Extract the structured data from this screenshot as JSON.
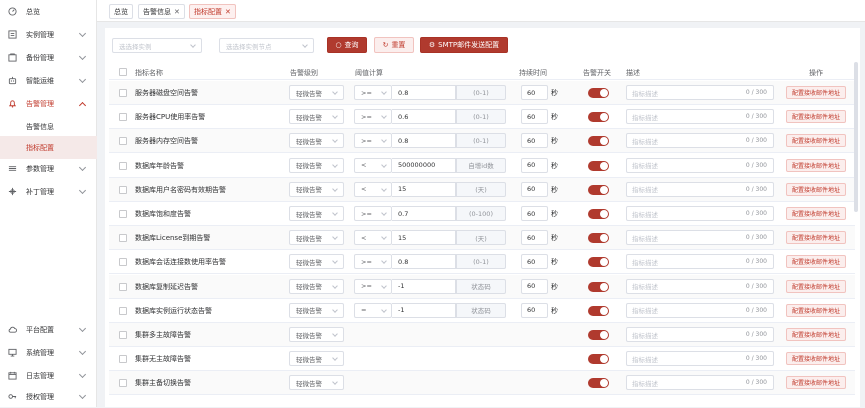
{
  "sidebar": {
    "items": [
      {
        "label": "总览",
        "icon": "gauge-icon"
      },
      {
        "label": "实例管理",
        "icon": "list-icon"
      },
      {
        "label": "备份管理",
        "icon": "backup-icon"
      },
      {
        "label": "智能运维",
        "icon": "robot-icon"
      },
      {
        "label": "告警管理",
        "icon": "bell-icon"
      },
      {
        "label": "参数管理",
        "icon": "sliders-icon"
      },
      {
        "label": "补丁管理",
        "icon": "patch-icon"
      },
      {
        "label": "平台配置",
        "icon": "cloud-icon"
      },
      {
        "label": "系统管理",
        "icon": "monitor-icon"
      },
      {
        "label": "日志管理",
        "icon": "calendar-icon"
      },
      {
        "label": "授权管理",
        "icon": "key-icon"
      }
    ],
    "sub_items": [
      {
        "label": "告警信息"
      },
      {
        "label": "指标配置"
      }
    ]
  },
  "tabs": [
    {
      "label": "总览"
    },
    {
      "label": "告警信息"
    },
    {
      "label": "指标配置"
    }
  ],
  "toolbar": {
    "instance_placeholder": "选选择实例",
    "node_placeholder": "选选择实例节点",
    "query_label": "查询",
    "reset_label": "重置",
    "smtp_label": "SMTP邮件发送配置"
  },
  "table": {
    "headers": [
      "指标名称",
      "告警级别",
      "阈值计算",
      "持续时间",
      "告警开关",
      "描述",
      "操作"
    ],
    "seconds_unit": "秒",
    "desc_placeholder": "指标描述",
    "desc_count": "0 / 300",
    "action_label": "配置接收邮件地址",
    "rows": [
      {
        "name": "服务器磁盘空间告警",
        "level": "轻微告警",
        "op": ">=",
        "value": "0.8",
        "unit": "(0-1)",
        "duration": "60"
      },
      {
        "name": "服务器CPU使用率告警",
        "level": "轻微告警",
        "op": ">=",
        "value": "0.6",
        "unit": "(0-1)",
        "duration": "60"
      },
      {
        "name": "服务器内存空间告警",
        "level": "轻微告警",
        "op": ">=",
        "value": "0.8",
        "unit": "(0-1)",
        "duration": "60"
      },
      {
        "name": "数据库年龄告警",
        "level": "轻微告警",
        "op": "<",
        "value": "500000000",
        "unit": "自增id数",
        "duration": "60"
      },
      {
        "name": "数据库用户名密码有效期告警",
        "level": "轻微告警",
        "op": "<",
        "value": "15",
        "unit": "(天)",
        "duration": "60"
      },
      {
        "name": "数据库饱和度告警",
        "level": "轻微告警",
        "op": ">=",
        "value": "0.7",
        "unit": "(0-100)",
        "duration": "60"
      },
      {
        "name": "数据库License到期告警",
        "level": "轻微告警",
        "op": "<",
        "value": "15",
        "unit": "(天)",
        "duration": "60"
      },
      {
        "name": "数据库会话连接数使用率告警",
        "level": "轻微告警",
        "op": ">=",
        "value": "0.8",
        "unit": "(0-1)",
        "duration": "60"
      },
      {
        "name": "数据库复制延迟告警",
        "level": "轻微告警",
        "op": ">=",
        "value": "-1",
        "unit": "状态码",
        "duration": "60"
      },
      {
        "name": "数据库实例运行状态告警",
        "level": "轻微告警",
        "op": "=",
        "value": "-1",
        "unit": "状态码",
        "duration": "60"
      },
      {
        "name": "集群多主故障告警",
        "level": "轻微告警",
        "op": "",
        "value": "",
        "unit": "",
        "duration": ""
      },
      {
        "name": "集群无主故障告警",
        "level": "轻微告警",
        "op": "",
        "value": "",
        "unit": "",
        "duration": ""
      },
      {
        "name": "集群主备切换告警",
        "level": "轻微告警",
        "op": "",
        "value": "",
        "unit": "",
        "duration": ""
      }
    ]
  },
  "colors": {
    "accent": "#b03a2e",
    "accent_light": "#fbeeed"
  }
}
